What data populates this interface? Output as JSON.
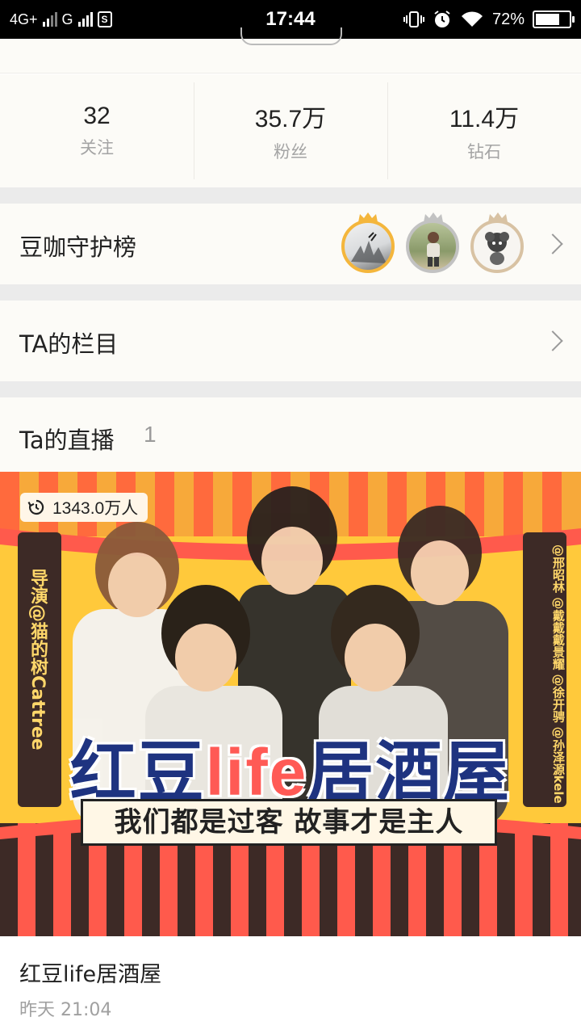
{
  "status_bar": {
    "network_1": "4G+",
    "network_2": "G",
    "sim_icon": "S",
    "time": "17:44",
    "battery": "72%",
    "battery_level": 0.72
  },
  "stats": [
    {
      "value": "32",
      "label": "关注"
    },
    {
      "value": "35.7万",
      "label": "粉丝"
    },
    {
      "value": "11.4万",
      "label": "钻石"
    }
  ],
  "guard": {
    "title": "豆咖守护榜",
    "avatars": [
      "avatar-gold",
      "avatar-silver",
      "avatar-bronze"
    ]
  },
  "columns": {
    "title": "TA的栏目"
  },
  "live": {
    "title": "Ta的直播",
    "count": "1",
    "item": {
      "views": "1343.0万人",
      "banner_title_1": "红豆",
      "banner_title_2": "life",
      "banner_title_3": "居酒屋",
      "banner_subtitle": "我们都是过客 故事才是主人",
      "side_left": "导演@猫的树Cattree",
      "side_right": "@邢昭林 @戴戴戴景耀 @徐开骋 @孙泽源kele",
      "title": "红豆life居酒屋",
      "time": "昨天 21:04"
    }
  },
  "colors": {
    "gold": "#f4b63c",
    "silver": "#c2c2c2",
    "bronze": "#d8c2a3",
    "title_blue": "#1e3380",
    "life_red": "#ff5a55"
  }
}
